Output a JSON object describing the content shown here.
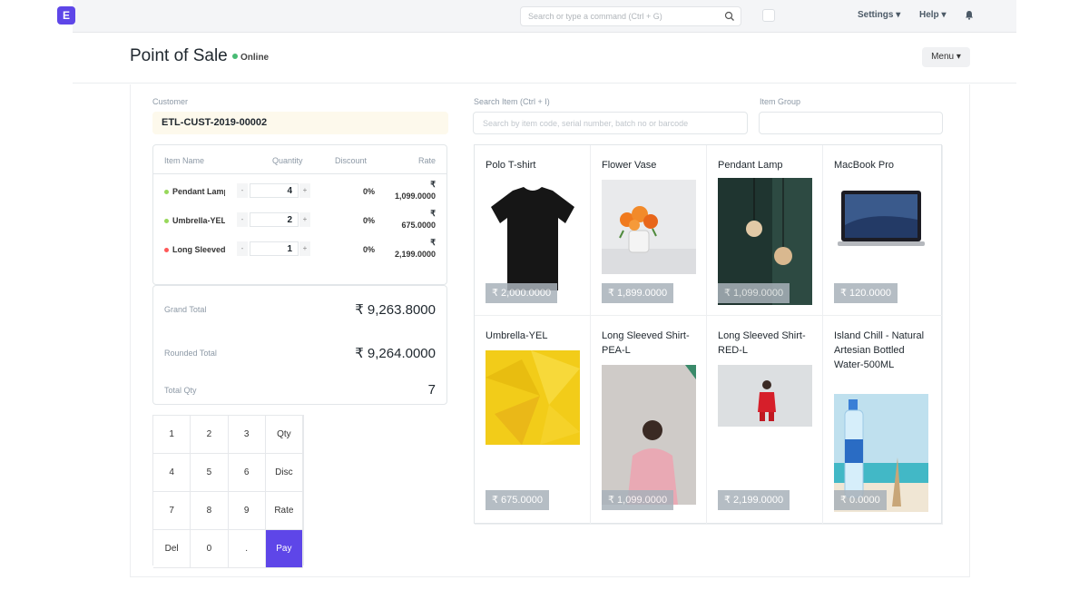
{
  "navbar": {
    "logo": "E",
    "search_placeholder": "Search or type a command (Ctrl + G)",
    "settings": "Settings ▾",
    "help": "Help ▾"
  },
  "header": {
    "title": "Point of Sale",
    "status": "Online",
    "menu": "Menu ▾"
  },
  "customer": {
    "label": "Customer",
    "value": "ETL-CUST-2019-00002"
  },
  "cart": {
    "columns": [
      "Item Name",
      "Quantity",
      "Discount",
      "Rate"
    ],
    "items": [
      {
        "name": "Pendant Lamp",
        "qty": "4",
        "discount": "0%",
        "currency": "₹",
        "rate": "1,099.0000",
        "color": "#98d85b"
      },
      {
        "name": "Umbrella-YEL",
        "qty": "2",
        "discount": "0%",
        "currency": "₹",
        "rate": "675.0000",
        "color": "#98d85b"
      },
      {
        "name": "Long Sleeved Shirt",
        "qty": "1",
        "discount": "0%",
        "currency": "₹",
        "rate": "2,199.0000",
        "color": "#ff5858"
      }
    ],
    "minus": "-",
    "plus": "+"
  },
  "totals": {
    "grand_label": "Grand Total",
    "grand_value": "₹ 9,263.8000",
    "rounded_label": "Rounded Total",
    "rounded_value": "₹ 9,264.0000",
    "qty_label": "Total Qty",
    "qty_value": "7"
  },
  "numpad": [
    "1",
    "2",
    "3",
    "Qty",
    "4",
    "5",
    "6",
    "Disc",
    "7",
    "8",
    "9",
    "Rate",
    "Del",
    "0",
    ".",
    "Pay"
  ],
  "search": {
    "label": "Search Item (Ctrl + I)",
    "placeholder": "Search by item code, serial number, batch no or barcode",
    "group_label": "Item Group"
  },
  "products": [
    {
      "name": "Polo T-shirt",
      "price": "₹ 2,000.0000",
      "icon": "tshirt-image"
    },
    {
      "name": "Flower Vase",
      "price": "₹ 1,899.0000",
      "icon": "flower-vase-image"
    },
    {
      "name": "Pendant Lamp",
      "price": "₹ 1,099.0000",
      "icon": "pendant-lamp-image"
    },
    {
      "name": "MacBook Pro",
      "price": "₹ 120.0000",
      "icon": "laptop-image"
    },
    {
      "name": "Umbrella-YEL",
      "price": "₹ 675.0000",
      "icon": "umbrella-image"
    },
    {
      "name": "Long Sleeved Shirt-PEA-L",
      "price": "₹ 1,099.0000",
      "icon": "person-pink-shirt-image"
    },
    {
      "name": "Long Sleeved Shirt-RED-L",
      "price": "₹ 2,199.0000",
      "icon": "person-red-shirt-image"
    },
    {
      "name": "Island Chill - Natural Artesian Bottled Water-500ML",
      "price": "₹ 0.0000",
      "icon": "water-bottle-image"
    }
  ],
  "colors": {
    "accent": "#5e46e8",
    "online": "#48bb74"
  }
}
